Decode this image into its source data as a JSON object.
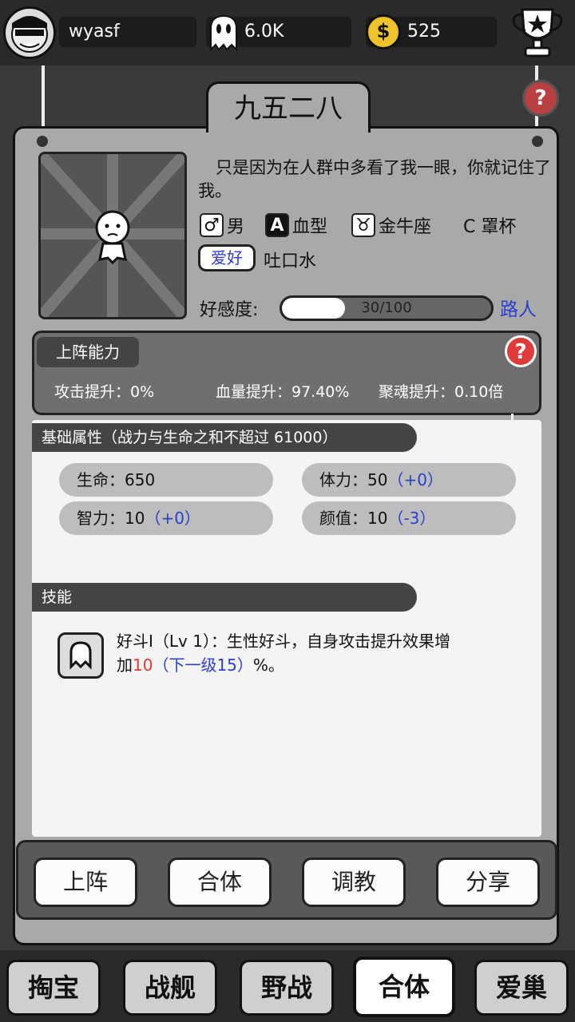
{
  "topbar": {
    "username": "wyasf",
    "ghost_currency": "6.0K",
    "coin_currency": "525",
    "icons": [
      "avatar",
      "ghost-icon",
      "coin-icon",
      "trophy-icon"
    ]
  },
  "character": {
    "name": "九五二八",
    "description": "只是因为在人群中多看了我一眼，你就记住了我。",
    "gender_icon": "♂",
    "gender": "男",
    "blood_icon": "A",
    "blood_label": "血型",
    "zodiac_icon": "♉",
    "zodiac": "金牛座",
    "cup": "C 罩杯",
    "hobby_tag": "爱好",
    "hobby": "吐口水",
    "affection_label": "好感度:",
    "affection_value": "30/100",
    "affection_ratio": 0.3,
    "affection_level": "路人"
  },
  "ability": {
    "title": "上阵能力",
    "attack": "攻击提升：0%",
    "hp": "血量提升：97.40%",
    "soul": "聚魂提升：0.10倍",
    "hint": "?"
  },
  "base_attrs": {
    "title": "基础属性（战力与生命之和不超过 61000）",
    "life_label": "生命：650",
    "stamina_label": "体力：50",
    "stamina_bonus": "（+0）",
    "int_label": "智力：10",
    "int_bonus": "（+0）",
    "looks_label": "颜值：10",
    "looks_bonus": "（-3）"
  },
  "skills": {
    "title": "技能",
    "line1": "好斗Ⅰ（Lv 1）：生性好斗，自身攻击提升效果增",
    "line2_prefix": "加",
    "line2_value": "10",
    "line2_next": "（下一级15）",
    "line2_suffix": "%。"
  },
  "actions": [
    "上阵",
    "合体",
    "调教",
    "分享"
  ],
  "nav": [
    "掏宝",
    "战舰",
    "野战",
    "合体",
    "爱巢"
  ],
  "nav_active": "合体",
  "colors": {
    "accent_blue": "#2a3fd0",
    "accent_red": "#e03a3a",
    "card": "#a9a9a9"
  }
}
